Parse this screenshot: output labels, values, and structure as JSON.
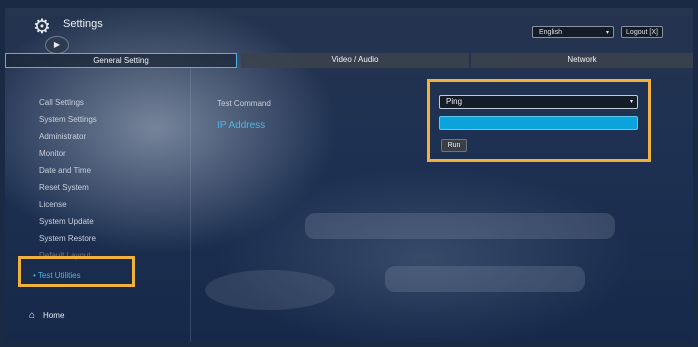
{
  "header": {
    "title": "Settings",
    "gear_icon": "gear-icon",
    "camera_icon": "camera-off-icon",
    "language": "English",
    "logout_label": "Logout [X]"
  },
  "tabs": [
    {
      "label": "General Setting",
      "active": true
    },
    {
      "label": "Video / Audio",
      "active": false
    },
    {
      "label": "Network",
      "active": false
    }
  ],
  "sidebar": {
    "items": [
      {
        "label": "Call Settings"
      },
      {
        "label": "System Settings"
      },
      {
        "label": "Administrator"
      },
      {
        "label": "Monitor"
      },
      {
        "label": "Date and Time"
      },
      {
        "label": "Reset System"
      },
      {
        "label": "License"
      },
      {
        "label": "System Update"
      },
      {
        "label": "System Restore"
      },
      {
        "label": "Default Layout"
      },
      {
        "label": "Test Utilities",
        "active": true
      }
    ],
    "home_label": "Home"
  },
  "main": {
    "test_command_label": "Test Command",
    "ip_address_label": "IP Address",
    "command_value": "Ping",
    "ip_value": "",
    "run_label": "Run"
  },
  "colors": {
    "accent": "#4cb5e8",
    "highlight": "#f0b23c",
    "input_active": "#0aa3dc"
  }
}
